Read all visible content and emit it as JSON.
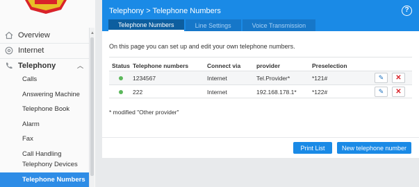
{
  "header": {
    "breadcrumb": "Telephony > Telephone Numbers",
    "help_glyph": "?",
    "tabs": [
      {
        "label": "Telephone Numbers",
        "active": true
      },
      {
        "label": "Line Settings",
        "active": false
      },
      {
        "label": "Voice Transmission",
        "active": false
      }
    ]
  },
  "sidebar": {
    "top_items": [
      {
        "label": "Overview",
        "icon": "home-icon"
      },
      {
        "label": "Internet",
        "icon": "globe-icon"
      },
      {
        "label": "Telephony",
        "icon": "phone-icon",
        "expanded": true
      }
    ],
    "sub_items": [
      {
        "label": "Calls"
      },
      {
        "label": "Answering Machine"
      },
      {
        "label": "Telephone Book"
      },
      {
        "label": "Alarm"
      },
      {
        "label": "Fax"
      },
      {
        "label": "Call Handling"
      },
      {
        "label": "Telephony Devices"
      },
      {
        "label": "Telephone Numbers",
        "active": true
      }
    ]
  },
  "main": {
    "intro": "On this page you can set up and edit your own telephone numbers.",
    "table": {
      "headers": [
        "Status",
        "Telephone numbers",
        "Connect via",
        "provider",
        "Preselection"
      ],
      "rows": [
        {
          "status": "active",
          "number": "1234567",
          "connect_via": "Internet",
          "provider": "Tel.Provider*",
          "preselection": "*121#"
        },
        {
          "status": "active",
          "number": "222",
          "connect_via": "Internet",
          "provider": "192.168.178.1*",
          "preselection": "*122#"
        }
      ]
    },
    "note": "* modified \"Other provider\"",
    "buttons": {
      "print": "Print List",
      "new": "New telephone number"
    }
  },
  "colors": {
    "accent": "#1a8ae6",
    "active_nav": "#2d8ce6",
    "status_ok": "#5cb85c",
    "delete": "#d9232a"
  }
}
